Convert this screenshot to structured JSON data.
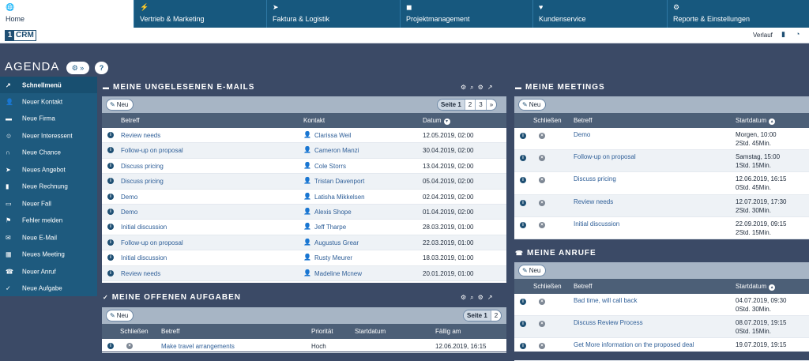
{
  "nav": {
    "tabs": [
      {
        "label": "Home",
        "icon": "globe-icon",
        "glyph": "🌐"
      },
      {
        "label": "Vertrieb & Marketing",
        "icon": "bolt-icon",
        "glyph": "⚡"
      },
      {
        "label": "Faktura & Logistik",
        "icon": "paper-plane-icon",
        "glyph": "➤"
      },
      {
        "label": "Projektmanagement",
        "icon": "cube-icon",
        "glyph": "◼"
      },
      {
        "label": "Kundenservice",
        "icon": "heart-icon",
        "glyph": "♥"
      },
      {
        "label": "Reporte & Einstellungen",
        "icon": "gear-icon",
        "glyph": "⚙"
      }
    ]
  },
  "subbar": {
    "logo_number": "1",
    "logo_text": "CRM",
    "history": "Verlauf"
  },
  "page": {
    "title": "AGENDA",
    "settings_glyph": "⚙ »",
    "help_glyph": "?"
  },
  "sidebar": {
    "header": "Schnellmenü",
    "header_glyph": "↗",
    "items": [
      {
        "label": "Neuer Kontakt",
        "glyph": "👤"
      },
      {
        "label": "Neue Firma",
        "glyph": "▬"
      },
      {
        "label": "Neuer Interessent",
        "glyph": "☺"
      },
      {
        "label": "Neue Chance",
        "glyph": "∩"
      },
      {
        "label": "Neues Angebot",
        "glyph": "➤"
      },
      {
        "label": "Neue Rechnung",
        "glyph": "▮"
      },
      {
        "label": "Neuer Fall",
        "glyph": "▭"
      },
      {
        "label": "Fehler melden",
        "glyph": "⚑"
      },
      {
        "label": "Neue E-Mail",
        "glyph": "✉"
      },
      {
        "label": "Neues Meeting",
        "glyph": "▦"
      },
      {
        "label": "Neuer Anruf",
        "glyph": "☎"
      },
      {
        "label": "Neue Aufgabe",
        "glyph": "✓"
      }
    ]
  },
  "colors": {
    "nav": "#17587e",
    "sidebar": "#1e5a7e",
    "background": "#3b4a66",
    "table_header": "#4c5f77",
    "link": "#2f5f98"
  },
  "emails": {
    "title": "MEINE UNGELESENEN E-MAILS",
    "title_glyph": "▬",
    "tools": [
      "⚙",
      "⌕",
      "⚙",
      "↗"
    ],
    "new_label": "Neu",
    "pager": [
      "Seite 1",
      "2",
      "3",
      "»"
    ],
    "columns": {
      "subject": "Betreff",
      "contact": "Kontakt",
      "date": "Datum"
    },
    "rows": [
      {
        "subject": "Review needs",
        "contact": "Clarissa Weil",
        "date": "12.05.2019, 02:00"
      },
      {
        "subject": "Follow-up on proposal",
        "contact": "Cameron Manzi",
        "date": "30.04.2019, 02:00"
      },
      {
        "subject": "Discuss pricing",
        "contact": "Cole Storrs",
        "date": "13.04.2019, 02:00"
      },
      {
        "subject": "Discuss pricing",
        "contact": "Tristan Davenport",
        "date": "05.04.2019, 02:00"
      },
      {
        "subject": "Demo",
        "contact": "Latisha Mikkelsen",
        "date": "02.04.2019, 02:00"
      },
      {
        "subject": "Demo",
        "contact": "Alexis Shope",
        "date": "01.04.2019, 02:00"
      },
      {
        "subject": "Initial discussion",
        "contact": "Jeff Tharpe",
        "date": "28.03.2019, 01:00"
      },
      {
        "subject": "Follow-up on proposal",
        "contact": "Augustus Grear",
        "date": "22.03.2019, 01:00"
      },
      {
        "subject": "Initial discussion",
        "contact": "Rusty Meurer",
        "date": "18.03.2019, 01:00"
      },
      {
        "subject": "Review needs",
        "contact": "Madeline Mcnew",
        "date": "20.01.2019, 01:00"
      }
    ]
  },
  "tasks": {
    "title": "MEINE OFFENEN AUFGABEN",
    "title_glyph": "✓",
    "tools": [
      "⚙",
      "⌕",
      "⚙",
      "↗"
    ],
    "new_label": "Neu",
    "pager": [
      "Seite 1",
      "2"
    ],
    "columns": {
      "close": "Schließen",
      "subject": "Betreff",
      "priority": "Priorität",
      "start": "Startdatum",
      "due": "Fällig am"
    },
    "rows": [
      {
        "subject": "Make travel arrangements",
        "priority": "Hoch",
        "start": "",
        "due": "12.06.2019, 16:15"
      }
    ]
  },
  "meetings": {
    "title": "MEINE MEETINGS",
    "title_glyph": "▬",
    "new_label": "Neu",
    "columns": {
      "close": "Schließen",
      "subject": "Betreff",
      "start": "Startdatum"
    },
    "rows": [
      {
        "subject": "Demo",
        "date": "Morgen, 10:00",
        "duration": "2Std. 45Min."
      },
      {
        "subject": "Follow-up on proposal",
        "date": "Samstag, 15:00",
        "duration": "1Std. 15Min."
      },
      {
        "subject": "Discuss pricing",
        "date": "12.06.2019, 16:15",
        "duration": "0Std. 45Min."
      },
      {
        "subject": "Review needs",
        "date": "12.07.2019, 17:30",
        "duration": "2Std. 30Min."
      },
      {
        "subject": "Initial discussion",
        "date": "22.09.2019, 09:15",
        "duration": "2Std. 15Min."
      }
    ]
  },
  "calls": {
    "title": "MEINE ANRUFE",
    "title_glyph": "☎",
    "new_label": "Neu",
    "columns": {
      "close": "Schließen",
      "subject": "Betreff",
      "start": "Startdatum"
    },
    "rows": [
      {
        "subject": "Bad time, will call back",
        "date": "04.07.2019, 09:30",
        "duration": "0Std. 30Min."
      },
      {
        "subject": "Discuss Review Process",
        "date": "08.07.2019, 19:15",
        "duration": "0Std. 15Min."
      },
      {
        "subject": "Get More information on the proposed deal",
        "date": "19.07.2019, 19:15",
        "duration": ""
      }
    ]
  }
}
